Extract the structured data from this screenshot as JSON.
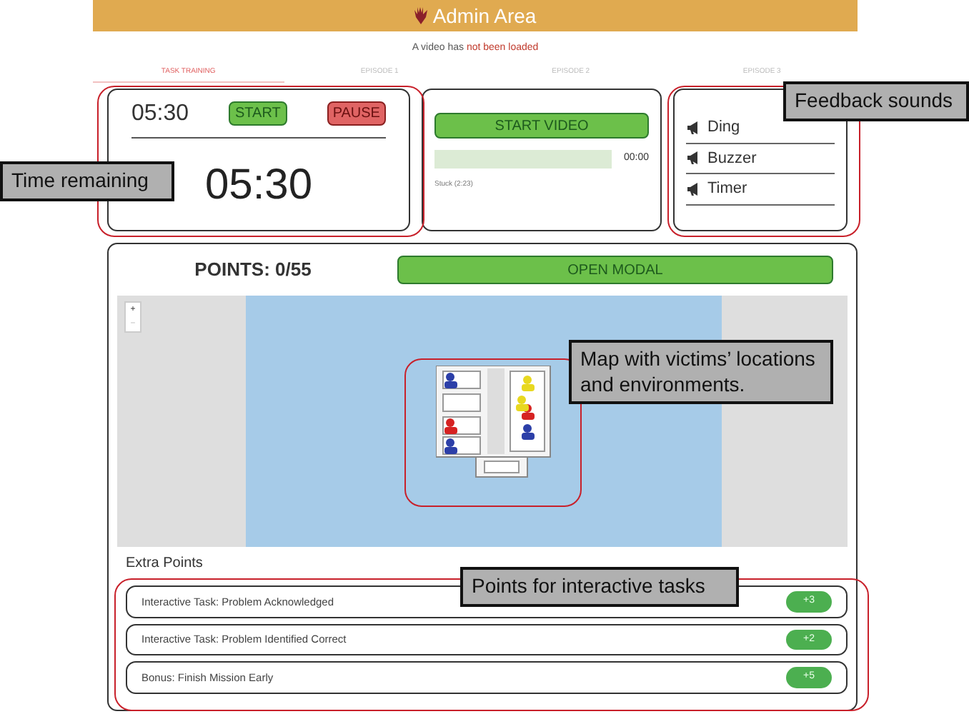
{
  "header": {
    "title": "Admin Area"
  },
  "notice": {
    "text": "A video has",
    "highlight": "not been loaded"
  },
  "tabs": [
    {
      "label": "TASK TRAINING",
      "selected": true
    },
    {
      "label": "EPISODE 1",
      "selected": false
    },
    {
      "label": "EPISODE 2",
      "selected": false
    },
    {
      "label": "EPISODE 3",
      "selected": false
    }
  ],
  "timer": {
    "time": "05:30",
    "start": "START",
    "pause": "PAUSE",
    "remaining": "05:30"
  },
  "video": {
    "button": "START VIDEO",
    "time": "00:00",
    "caption": "Stuck (2:23)"
  },
  "sounds": [
    {
      "label": "Ding"
    },
    {
      "label": "Buzzer"
    },
    {
      "label": "Timer"
    }
  ],
  "points": {
    "label": "POINTS: 0/55",
    "button": "OPEN MODAL"
  },
  "map": {
    "zoom_in": "+",
    "zoom_out": "−"
  },
  "extra_points": {
    "title": "Extra Points",
    "items": [
      {
        "label": "Interactive Task: Problem Acknowledged",
        "points": "+3"
      },
      {
        "label": "Interactive Task: Problem Identified Correct",
        "points": "+2"
      },
      {
        "label": "Bonus: Finish Mission Early",
        "points": "+5"
      }
    ]
  },
  "annotations": [
    {
      "text": "Time remaining"
    },
    {
      "text": "Feedback sounds"
    },
    {
      "text": "Map with victims’ locations and environments."
    },
    {
      "text": "Points for interactive tasks"
    }
  ]
}
